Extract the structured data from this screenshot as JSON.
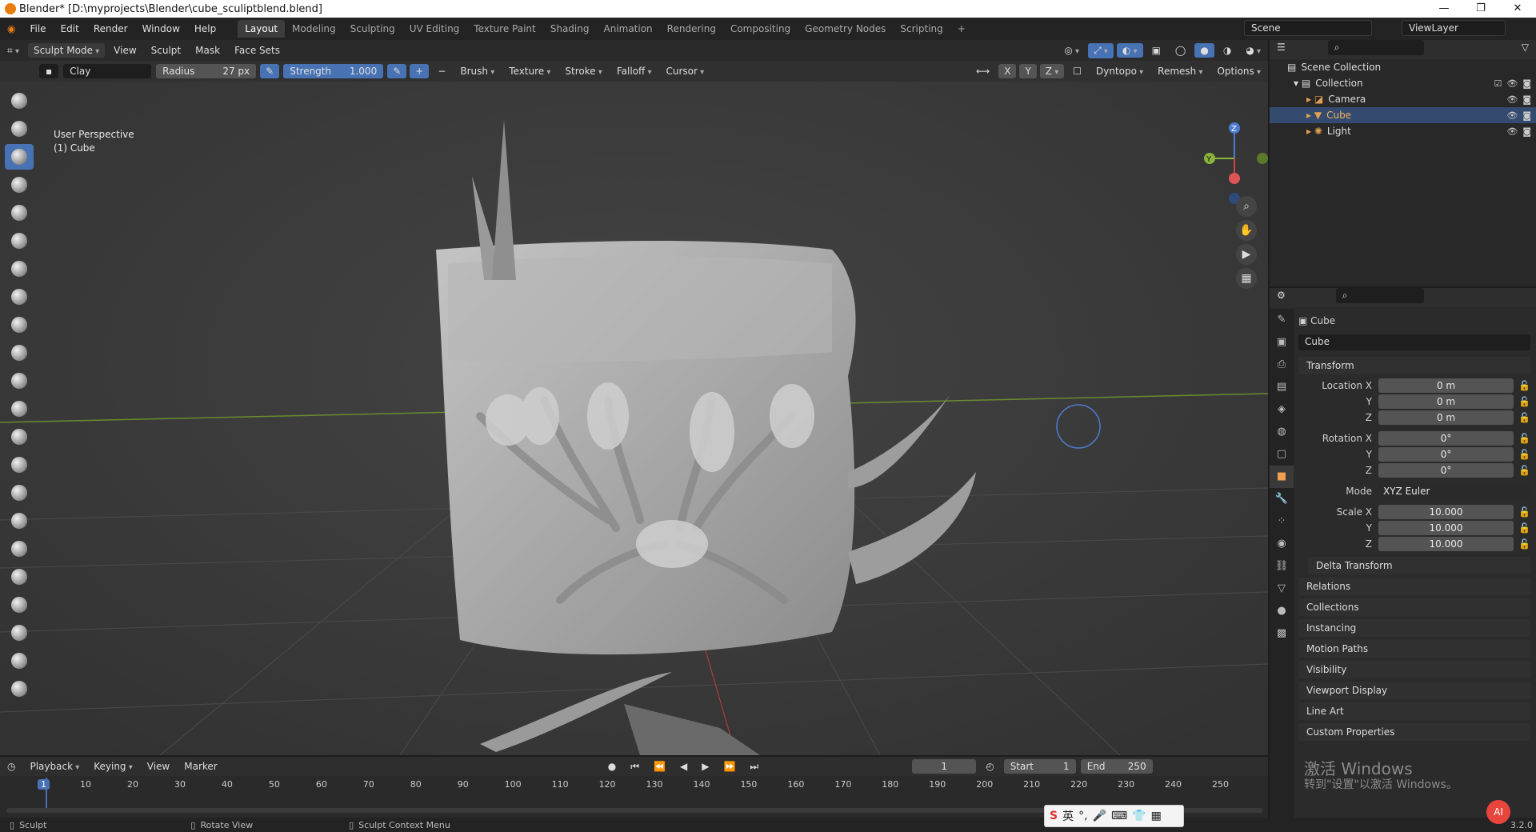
{
  "window": {
    "title": "Blender* [D:\\myprojects\\Blender\\cube_sculiptblend.blend]",
    "minimize": "—",
    "maximize": "❐",
    "close": "✕"
  },
  "menu": [
    "File",
    "Edit",
    "Render",
    "Window",
    "Help"
  ],
  "workspaces": [
    "Layout",
    "Modeling",
    "Sculpting",
    "UV Editing",
    "Texture Paint",
    "Shading",
    "Animation",
    "Rendering",
    "Compositing",
    "Geometry Nodes",
    "Scripting",
    "+"
  ],
  "active_workspace": "Layout",
  "scene": {
    "label": "Scene",
    "view_layer": "ViewLayer"
  },
  "viewport_header": {
    "mode": "Sculpt Mode",
    "menus": [
      "View",
      "Sculpt",
      "Mask",
      "Face Sets"
    ]
  },
  "tool_header": {
    "brush_name": "Clay",
    "radius_label": "Radius",
    "radius_value": "27 px",
    "strength_label": "Strength",
    "strength_value": "1.000",
    "plus": "+",
    "minus": "−",
    "menus": [
      "Brush",
      "Texture",
      "Stroke",
      "Falloff",
      "Cursor"
    ],
    "axes": [
      "X",
      "Y",
      "Z"
    ],
    "dyntopo": "Dyntopo",
    "remesh": "Remesh",
    "options": "Options"
  },
  "viewport_info": {
    "line1": "User Perspective",
    "line2": "(1) Cube"
  },
  "gizmo": {
    "x": "X",
    "y": "Y",
    "z": "Z"
  },
  "outliner": {
    "items": [
      {
        "label": "Scene Collection"
      },
      {
        "label": "Collection"
      },
      {
        "label": "Camera"
      },
      {
        "label": "Cube"
      },
      {
        "label": "Light"
      }
    ]
  },
  "properties": {
    "object_name": "Cube",
    "data_name": "Cube",
    "transform_title": "Transform",
    "location": {
      "label": "Location X",
      "x": "0 m",
      "y": "0 m",
      "z": "0 m"
    },
    "rotation": {
      "label": "Rotation X",
      "x": "0°",
      "y": "0°",
      "z": "0°"
    },
    "mode_label": "Mode",
    "mode_value": "XYZ Euler",
    "scale": {
      "label": "Scale X",
      "x": "10.000",
      "y": "10.000",
      "z": "10.000"
    },
    "axis_y": "Y",
    "axis_z": "Z",
    "panels": [
      "Delta Transform",
      "Relations",
      "Collections",
      "Instancing",
      "Motion Paths",
      "Visibility",
      "Viewport Display",
      "Line Art",
      "Custom Properties"
    ]
  },
  "timeline": {
    "menus": [
      "Playback",
      "Keying",
      "View",
      "Marker"
    ],
    "current_frame": "1",
    "start_label": "Start",
    "start_value": "1",
    "end_label": "End",
    "end_value": "250",
    "frames": [
      "1",
      "10",
      "20",
      "30",
      "40",
      "50",
      "60",
      "70",
      "80",
      "90",
      "100",
      "110",
      "120",
      "130",
      "140",
      "150",
      "160",
      "170",
      "180",
      "190",
      "200",
      "210",
      "220",
      "230",
      "240",
      "250"
    ]
  },
  "status": {
    "left": "Sculpt",
    "middle": "Rotate View",
    "right": "Sculpt Context Menu",
    "version": "3.2.0"
  },
  "watermark": {
    "line1": "激活 Windows",
    "line2": "转到\"设置\"以激活 Windows。"
  },
  "ime": {
    "lang": "英"
  }
}
